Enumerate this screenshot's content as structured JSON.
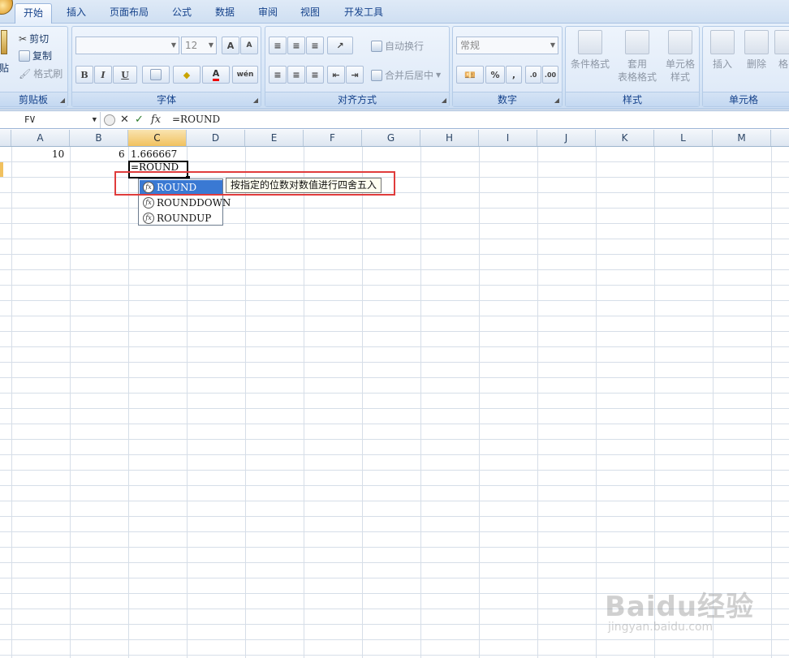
{
  "ribbon": {
    "tabs": [
      {
        "label": "开始",
        "active": true
      },
      {
        "label": "插入"
      },
      {
        "label": "页面布局"
      },
      {
        "label": "公式"
      },
      {
        "label": "数据"
      },
      {
        "label": "审阅"
      },
      {
        "label": "视图"
      },
      {
        "label": "开发工具"
      }
    ],
    "clipboard": {
      "paste": "贴",
      "cut": "剪切",
      "copy": "复制",
      "format_painter": "格式刷",
      "group": "剪贴板"
    },
    "font": {
      "size": "12",
      "bold": "B",
      "italic": "I",
      "underline": "U",
      "grow": "A",
      "shrink": "A",
      "phonetic": "wén",
      "group": "字体"
    },
    "alignment": {
      "wrap": "自动换行",
      "merge": "合并后居中",
      "group": "对齐方式"
    },
    "number": {
      "format": "常规",
      "percent": "%",
      "comma": ",",
      "group": "数字"
    },
    "styles": {
      "conditional": "条件格式",
      "table1": "套用",
      "table2": "表格格式",
      "cell1": "单元格",
      "cell2": "样式",
      "group": "样式"
    },
    "cells": {
      "insert": "插入",
      "delete": "删除",
      "format": "格",
      "group": "单元格"
    }
  },
  "formula_bar": {
    "name_box": "FV",
    "formula": "=ROUND",
    "cancel": "✕",
    "enter": "✓",
    "fx": "fx"
  },
  "columns": [
    "A",
    "B",
    "C",
    "D",
    "E",
    "F",
    "G",
    "H",
    "I",
    "J",
    "K",
    "L",
    "M"
  ],
  "cells": {
    "A1": "10",
    "B1": "6",
    "C1": "1.666667",
    "C2": "=ROUND"
  },
  "autocomplete": {
    "items": [
      "ROUND",
      "ROUNDDOWN",
      "ROUNDUP"
    ],
    "tooltip": "按指定的位数对数值进行四舍五入"
  },
  "watermark": {
    "logo": "Baidu经验",
    "url": "jingyan.baidu.com"
  }
}
